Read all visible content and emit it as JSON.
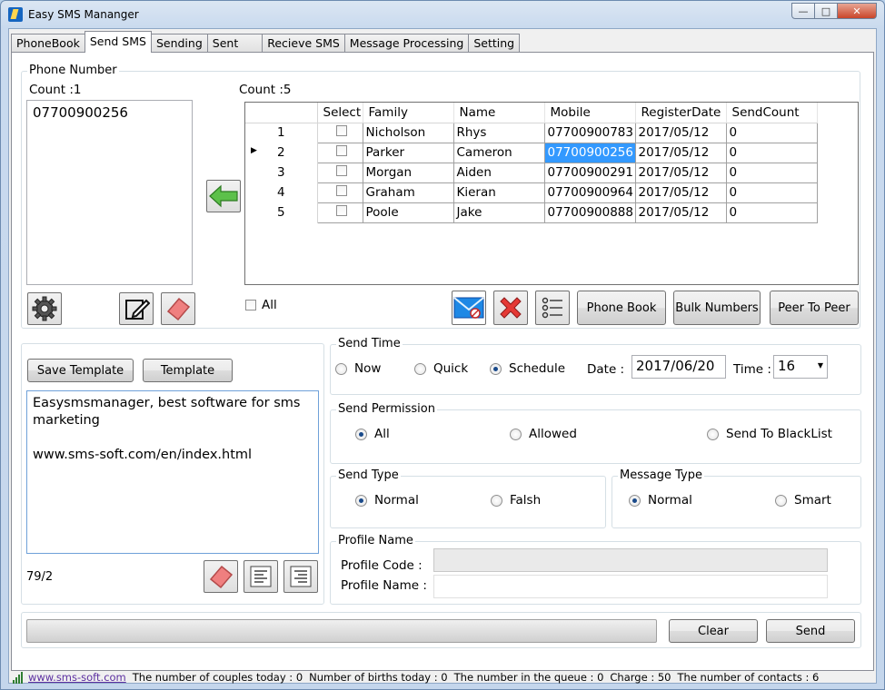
{
  "window": {
    "title": "Easy SMS Mananger"
  },
  "tabs": [
    "PhoneBook",
    "Send SMS",
    "Sending",
    "Sent",
    "Recieve SMS",
    "Message Processing",
    "Setting"
  ],
  "phone_number": {
    "legend": "Phone Number",
    "count_left": "Count :1",
    "count_right": "Count :5",
    "selected_numbers": [
      "07700900256"
    ],
    "all_label": "All"
  },
  "grid": {
    "columns": [
      "Select",
      "Family",
      "Name",
      "Mobile",
      "RegisterDate",
      "SendCount"
    ],
    "rows": [
      {
        "num": "1",
        "family": "Nicholson",
        "name": "Rhys",
        "mobile": "07700900783",
        "date": "2017/05/12",
        "count": "0"
      },
      {
        "num": "2",
        "family": "Parker",
        "name": "Cameron",
        "mobile": "07700900256",
        "date": "2017/05/12",
        "count": "0"
      },
      {
        "num": "3",
        "family": "Morgan",
        "name": "Aiden",
        "mobile": "07700900291",
        "date": "2017/05/12",
        "count": "0"
      },
      {
        "num": "4",
        "family": "Graham",
        "name": "Kieran",
        "mobile": "07700900964",
        "date": "2017/05/12",
        "count": "0"
      },
      {
        "num": "5",
        "family": "Poole",
        "name": "Jake",
        "mobile": "07700900888",
        "date": "2017/05/12",
        "count": "0"
      }
    ]
  },
  "buttons": {
    "phone_book": "Phone Book",
    "bulk_numbers": "Bulk Numbers",
    "peer_to_peer": "Peer To Peer",
    "save_template": "Save Template",
    "template": "Template",
    "clear": "Clear",
    "send": "Send"
  },
  "message": {
    "line1": "Easysmsmanager, best software for sms",
    "line2": "marketing",
    "line3": "www.sms-soft.com/en/index.html",
    "counter": "79/2"
  },
  "send_time": {
    "legend": "Send Time",
    "options": [
      "Now",
      "Quick",
      "Schedule"
    ],
    "date_label": "Date :",
    "date_value": "2017/06/20",
    "time_label": "Time :",
    "time_value": "16"
  },
  "send_permission": {
    "legend": "Send Permission",
    "options": [
      "All",
      "Allowed",
      "Send To BlackList"
    ]
  },
  "send_type": {
    "legend": "Send Type",
    "options": [
      "Normal",
      "Falsh"
    ]
  },
  "message_type": {
    "legend": "Message Type",
    "options": [
      "Normal",
      "Smart"
    ]
  },
  "profile": {
    "legend": "Profile Name",
    "code_label": "Profile Code :",
    "name_label": "Profile Name :"
  },
  "status_bar": {
    "link": "www.sms-soft.com",
    "couples": "The number of couples today : 0",
    "births": "Number of births today : 0",
    "queue": "The number in the queue : 0",
    "charge": "Charge : 50",
    "contacts": "The number of contacts : 6"
  },
  "colors": {
    "selection": "#3399ff",
    "accent_green": "#4caf50",
    "delete_red": "#d32f2f"
  }
}
